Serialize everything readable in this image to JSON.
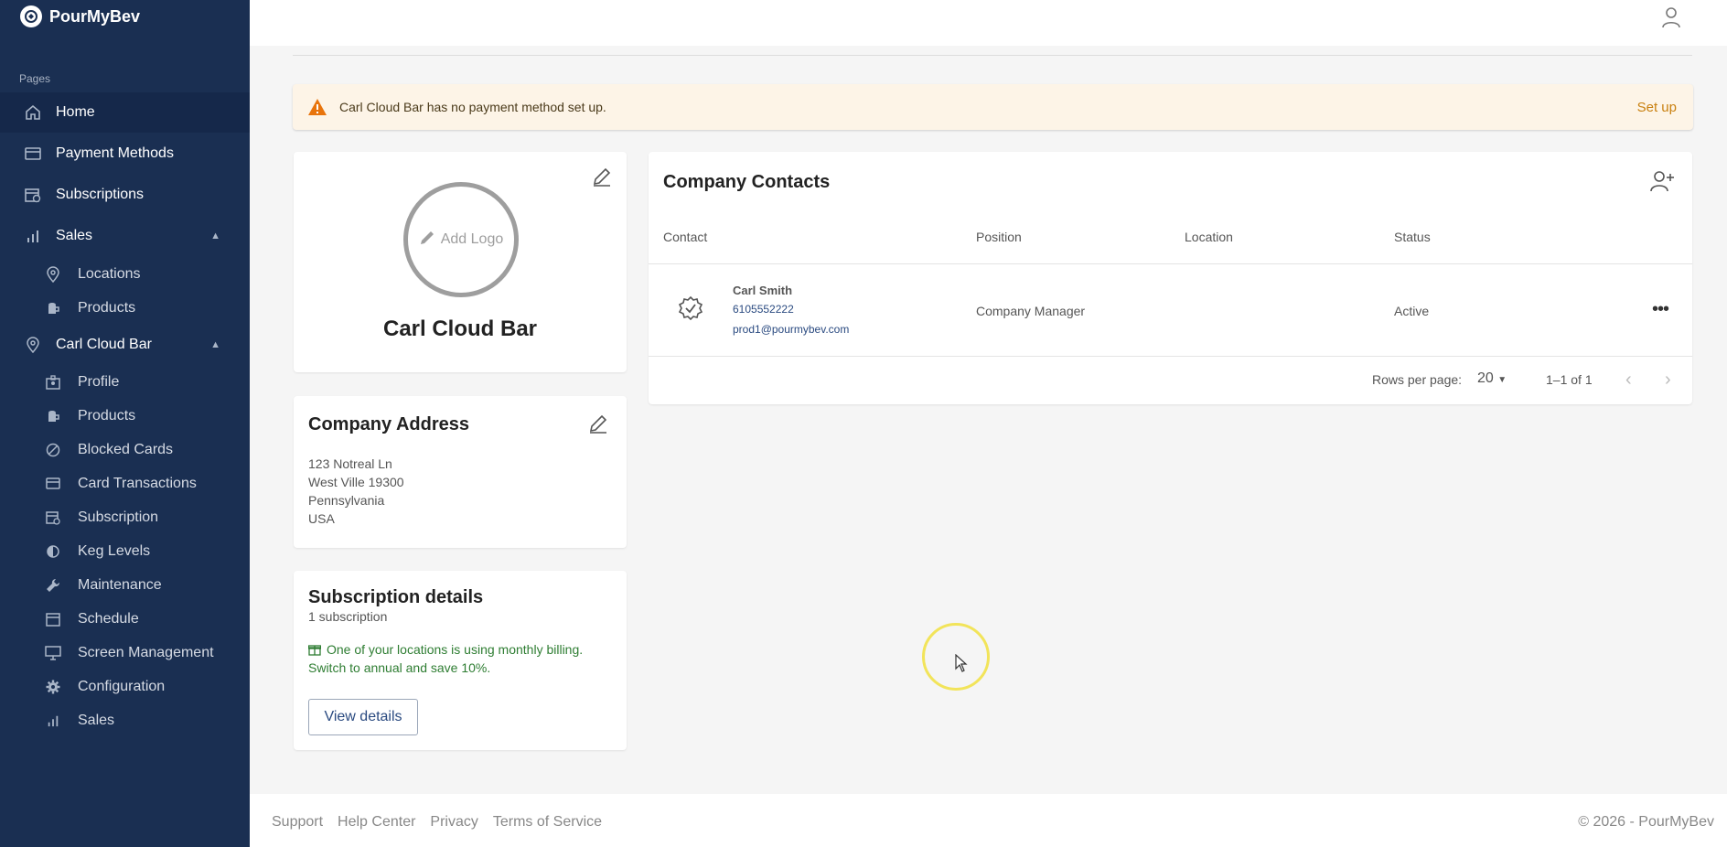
{
  "brand": {
    "name": "PourMyBev"
  },
  "sidebar": {
    "section_label": "Pages",
    "top_items": [
      {
        "label": "Home",
        "icon": "home-icon"
      },
      {
        "label": "Payment Methods",
        "icon": "credit-card-icon"
      },
      {
        "label": "Subscriptions",
        "icon": "calendar-refresh-icon"
      },
      {
        "label": "Sales",
        "icon": "bar-chart-icon"
      }
    ],
    "sales_items": [
      {
        "label": "Locations",
        "icon": "location-pin-icon"
      },
      {
        "label": "Products",
        "icon": "product-icon"
      }
    ],
    "company_item": {
      "label": "Carl Cloud Bar",
      "icon": "location-pin-icon"
    },
    "company_items": [
      {
        "label": "Profile",
        "icon": "profile-badge-icon"
      },
      {
        "label": "Products",
        "icon": "product-icon"
      },
      {
        "label": "Blocked Cards",
        "icon": "blocked-icon"
      },
      {
        "label": "Card Transactions",
        "icon": "credit-card-icon"
      },
      {
        "label": "Subscription",
        "icon": "calendar-refresh-icon"
      },
      {
        "label": "Keg Levels",
        "icon": "half-circle-icon"
      },
      {
        "label": "Maintenance",
        "icon": "wrench-icon"
      },
      {
        "label": "Schedule",
        "icon": "calendar-icon"
      },
      {
        "label": "Screen Management",
        "icon": "monitor-icon"
      },
      {
        "label": "Configuration",
        "icon": "gear-icon"
      },
      {
        "label": "Sales",
        "icon": "bar-chart-icon"
      }
    ]
  },
  "alert": {
    "text": "Carl Cloud Bar has no payment method set up.",
    "action": "Set up",
    "color": "#c98010"
  },
  "company": {
    "name": "Carl Cloud Bar",
    "add_logo": "Add Logo"
  },
  "address": {
    "title": "Company Address",
    "line1": "123 Notreal Ln",
    "line2": "West Ville 19300",
    "line3": "Pennsylvania",
    "line4": "USA"
  },
  "subscription": {
    "title": "Subscription details",
    "count": "1 subscription",
    "promo": "One of your locations is using monthly billing. Switch to annual and save 10%.",
    "button": "View details"
  },
  "contacts": {
    "title": "Company Contacts",
    "headers": {
      "contact": "Contact",
      "position": "Position",
      "location": "Location",
      "status": "Status"
    },
    "rows": [
      {
        "name": "Carl Smith",
        "phone": "6105552222",
        "email": "prod1@pourmybev.com",
        "position": "Company Manager",
        "location": "",
        "status": "Active"
      }
    ],
    "rows_per_page_label": "Rows per page:",
    "rows_per_page": "20",
    "range": "1–1 of 1"
  },
  "footer": {
    "links": [
      "Support",
      "Help Center",
      "Privacy",
      "Terms of Service"
    ],
    "copyright": "© 2026 - PourMyBev"
  }
}
